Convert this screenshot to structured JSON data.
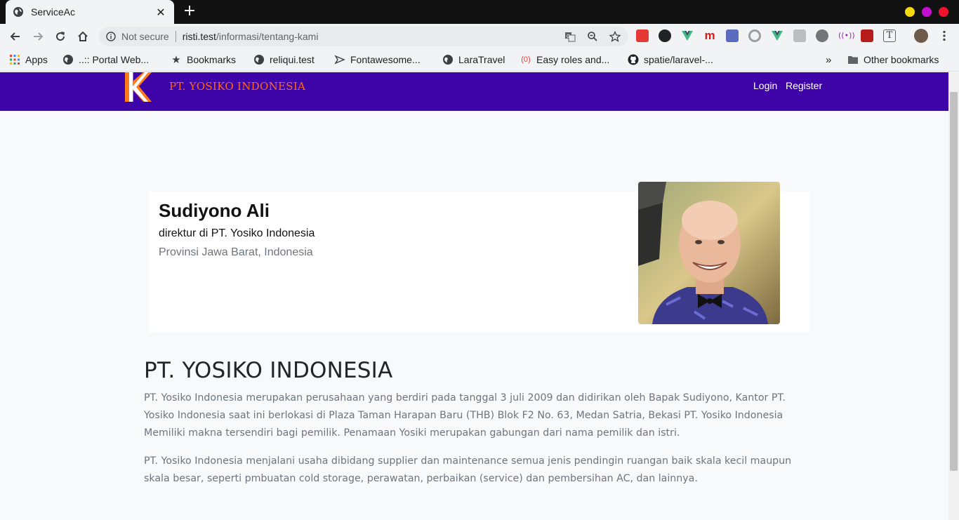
{
  "browser": {
    "tab_title": "ServiceAc",
    "security_label": "Not secure",
    "url_host": "risti.test",
    "url_path": "/informasi/tentang-kami",
    "window_controls": {
      "minimize": "#f6d90f",
      "maximize": "#c50ed2",
      "close": "#f0122d"
    }
  },
  "bookmarks": {
    "items": [
      "Apps",
      "..:: Portal Web...",
      "Bookmarks",
      "reliqui.test",
      "Fontawesome...",
      "LaraTravel",
      "Easy roles and...",
      "spatie/laravel-..."
    ],
    "overflow": "»",
    "other": "Other bookmarks"
  },
  "site": {
    "brand": "PT. YOSIKO INDONESIA",
    "nav": {
      "login": "Login",
      "register": "Register"
    },
    "colors": {
      "navbar": "#3e04a7",
      "brand_text": "#ff6a18"
    }
  },
  "profile": {
    "name": "Sudiyono Ali",
    "role": "direktur di PT. Yosiko Indonesia",
    "location": "Provinsi Jawa Barat, Indonesia"
  },
  "about": {
    "title": "PT. YOSIKO INDONESIA",
    "paragraphs": [
      "PT. Yosiko Indonesia merupakan perusahaan yang berdiri pada tanggal 3 juli 2009 dan didirikan oleh Bapak Sudiyono, Kantor PT. Yosiko Indonesia saat ini berlokasi di Plaza Taman Harapan Baru (THB) Blok F2 No. 63, Medan Satria, Bekasi PT. Yosiko Indonesia Memiliki makna tersendiri bagi pemilik. Penamaan Yosiki merupakan gabungan dari nama pemilik dan istri.",
      "PT. Yosiko Indonesia menjalani usaha dibidang supplier dan maintenance semua jenis pendingin ruangan baik skala kecil maupun skala besar, seperti pmbuatan cold storage, perawatan, perbaikan (service) dan pembersihan AC, dan lainnya."
    ]
  }
}
